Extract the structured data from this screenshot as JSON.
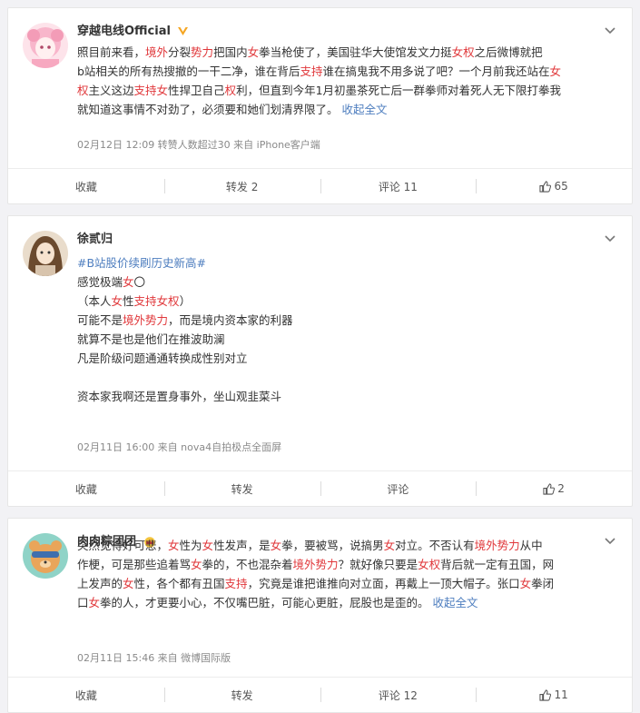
{
  "posts": [
    {
      "username": "穿越电线Official",
      "content_lines": [
        [
          {
            "t": "照目前来看，"
          },
          {
            "t": "境外",
            "c": "red"
          },
          {
            "t": "分裂"
          },
          {
            "t": "势力",
            "c": "red"
          },
          {
            "t": "把国内"
          },
          {
            "t": "女",
            "c": "red"
          },
          {
            "t": "拳当枪使了，美国驻华大使馆发文力挺"
          },
          {
            "t": "女权",
            "c": "red"
          },
          {
            "t": "之后微博就把"
          }
        ],
        [
          {
            "t": "b站相关的所有热搜撤的一干二净，谁在背后"
          },
          {
            "t": "支持",
            "c": "red"
          },
          {
            "t": "谁在搞鬼我不用多说了吧？一个月前我还站在"
          },
          {
            "t": "女",
            "c": "red"
          }
        ],
        [
          {
            "t": "权",
            "c": "red"
          },
          {
            "t": "主义这边"
          },
          {
            "t": "支持女",
            "c": "red"
          },
          {
            "t": "性捍卫自己"
          },
          {
            "t": "权",
            "c": "red"
          },
          {
            "t": "利，但直到今年1月初墨茶死亡后一群拳师对着死人无下限打拳我"
          }
        ],
        [
          {
            "t": "就知道这事情不对劲了，必须要和她们划清界限了。 "
          },
          {
            "t": "收起全文",
            "c": "blue"
          }
        ]
      ],
      "meta": "02月12日 12:09 转赞人数超过30 来自 iPhone客户端",
      "actions": {
        "favorite": "收藏",
        "repost": "转发 2",
        "comment": "评论 11",
        "like": "65"
      }
    },
    {
      "username": "徐贰归",
      "content_lines": [
        [
          {
            "t": "#B站股价续刷历史新高#",
            "c": "blue"
          }
        ],
        [
          {
            "t": "感觉极端"
          },
          {
            "t": "女",
            "c": "red"
          },
          {
            "t": "〇"
          }
        ],
        [
          {
            "t": "（本人"
          },
          {
            "t": "女",
            "c": "red"
          },
          {
            "t": "性"
          },
          {
            "t": "支持女权",
            "c": "red"
          },
          {
            "t": "）"
          }
        ],
        [
          {
            "t": "可能不是"
          },
          {
            "t": "境外势力",
            "c": "red"
          },
          {
            "t": "，而是境内资本家的利器"
          }
        ],
        [
          {
            "t": "就算不是也是他们在推波助澜"
          }
        ],
        [
          {
            "t": "凡是阶级问题通通转换成性别对立"
          }
        ],
        [
          {
            "t": ""
          }
        ],
        [
          {
            "t": "资本家我啊还是置身事外，坐山观韭菜斗"
          }
        ]
      ],
      "meta": "02月11日 16:00 来自 nova4自拍极点全面屏",
      "actions": {
        "favorite": "收藏",
        "repost": "转发",
        "comment": "评论",
        "like": "2"
      }
    },
    {
      "username": "肉肉粽团团",
      "content_lines": [
        [
          {
            "t": "突然觉得好可悲，"
          },
          {
            "t": "女",
            "c": "red"
          },
          {
            "t": "性为"
          },
          {
            "t": "女",
            "c": "red"
          },
          {
            "t": "性发声，是"
          },
          {
            "t": "女",
            "c": "red"
          },
          {
            "t": "拳，要被骂，说搞男"
          },
          {
            "t": "女",
            "c": "red"
          },
          {
            "t": "对立。不否认有"
          },
          {
            "t": "境外势力",
            "c": "red"
          },
          {
            "t": "从中"
          }
        ],
        [
          {
            "t": "作梗，可是那些追着骂"
          },
          {
            "t": "女",
            "c": "red"
          },
          {
            "t": "拳的，不也混杂着"
          },
          {
            "t": "境外势力",
            "c": "red"
          },
          {
            "t": "？就好像只要是"
          },
          {
            "t": "女权",
            "c": "red"
          },
          {
            "t": "背后就一定有丑国，网"
          }
        ],
        [
          {
            "t": "上发声的"
          },
          {
            "t": "女",
            "c": "red"
          },
          {
            "t": "性，各个都有丑国"
          },
          {
            "t": "支持",
            "c": "red"
          },
          {
            "t": "，究竟是谁把谁推向对立面，再戴上一顶大帽子。张口"
          },
          {
            "t": "女",
            "c": "red"
          },
          {
            "t": "拳闭"
          }
        ],
        [
          {
            "t": "口"
          },
          {
            "t": "女",
            "c": "red"
          },
          {
            "t": "拳的人，才更要小心，不仅嘴巴脏，可能心更脏，屁股也是歪的。 "
          },
          {
            "t": "收起全文",
            "c": "blue"
          }
        ]
      ],
      "meta": "02月11日 15:46 来自 微博国际版",
      "actions": {
        "favorite": "收藏",
        "repost": "转发",
        "comment": "评论 12",
        "like": "11"
      }
    }
  ],
  "colors": {
    "keyword": "#e0373a",
    "link": "#4e7ebf",
    "background": "#f2f2f5"
  }
}
